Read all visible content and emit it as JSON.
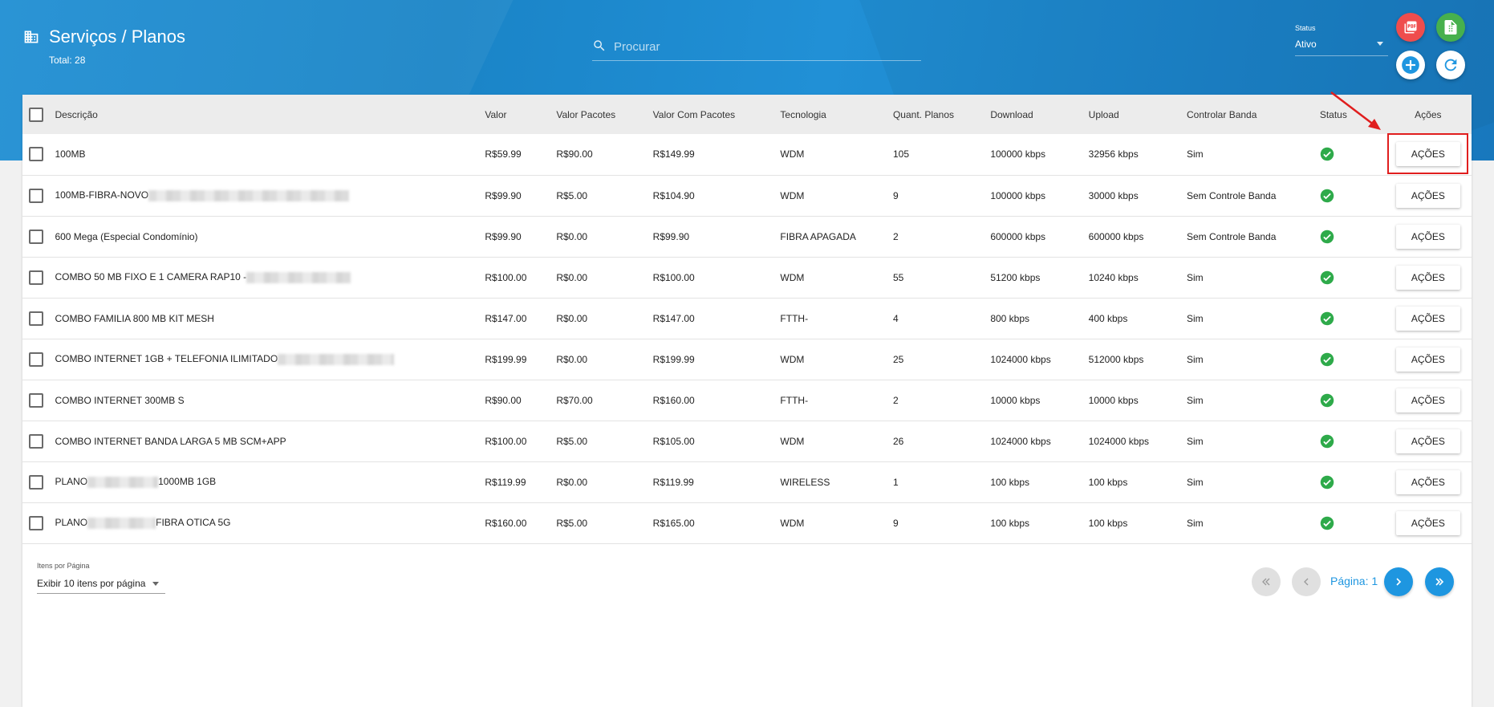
{
  "header": {
    "title": "Serviços / Planos",
    "total": "Total: 28",
    "search_placeholder": "Procurar",
    "status_label": "Status",
    "status_value": "Ativo"
  },
  "table": {
    "columns": [
      "Descrição",
      "Valor",
      "Valor Pacotes",
      "Valor Com Pacotes",
      "Tecnologia",
      "Quant. Planos",
      "Download",
      "Upload",
      "Controlar Banda",
      "Status",
      "Ações"
    ],
    "action_label": "AÇÕES",
    "rows": [
      {
        "desc": "100MB",
        "desc_suffix": "",
        "valor": "R$59.99",
        "pacotes": "R$90.00",
        "com_pacotes": "R$149.99",
        "tecnologia": "WDM",
        "quant": "105",
        "download": "100000 kbps",
        "upload": "32956 kbps",
        "banda": "Sim"
      },
      {
        "desc": "100MB-FIBRA-NOVO",
        "desc_suffix": "",
        "valor": "R$99.90",
        "pacotes": "R$5.00",
        "com_pacotes": "R$104.90",
        "tecnologia": "WDM",
        "quant": "9",
        "download": "100000 kbps",
        "upload": "30000 kbps",
        "banda": "Sem Controle Banda"
      },
      {
        "desc": "600 Mega (Especial Condomínio)",
        "desc_suffix": "",
        "valor": "R$99.90",
        "pacotes": "R$0.00",
        "com_pacotes": "R$99.90",
        "tecnologia": "FIBRA APAGADA",
        "quant": "2",
        "download": "600000 kbps",
        "upload": "600000 kbps",
        "banda": "Sem Controle Banda"
      },
      {
        "desc": "COMBO 50 MB FIXO E 1 CAMERA RAP10 -",
        "desc_suffix": "",
        "valor": "R$100.00",
        "pacotes": "R$0.00",
        "com_pacotes": "R$100.00",
        "tecnologia": "WDM",
        "quant": "55",
        "download": "51200 kbps",
        "upload": "10240 kbps",
        "banda": "Sim"
      },
      {
        "desc": "COMBO FAMILIA 800 MB KIT MESH",
        "desc_suffix": "",
        "valor": "R$147.00",
        "pacotes": "R$0.00",
        "com_pacotes": "R$147.00",
        "tecnologia": "FTTH-",
        "quant": "4",
        "download": "800 kbps",
        "upload": "400 kbps",
        "banda": "Sim"
      },
      {
        "desc": "COMBO INTERNET 1GB + TELEFONIA ILIMITADO",
        "desc_suffix": "",
        "valor": "R$199.99",
        "pacotes": "R$0.00",
        "com_pacotes": "R$199.99",
        "tecnologia": "WDM",
        "quant": "25",
        "download": "1024000 kbps",
        "upload": "512000 kbps",
        "banda": "Sim"
      },
      {
        "desc": "COMBO INTERNET 300MB S",
        "desc_suffix": "",
        "valor": "R$90.00",
        "pacotes": "R$70.00",
        "com_pacotes": "R$160.00",
        "tecnologia": "FTTH-",
        "quant": "2",
        "download": "10000 kbps",
        "upload": "10000 kbps",
        "banda": "Sim"
      },
      {
        "desc": "COMBO INTERNET BANDA LARGA 5 MB SCM+APP",
        "desc_suffix": "",
        "valor": "R$100.00",
        "pacotes": "R$5.00",
        "com_pacotes": "R$105.00",
        "tecnologia": "WDM",
        "quant": "26",
        "download": "1024000 kbps",
        "upload": "1024000 kbps",
        "banda": "Sim"
      },
      {
        "desc": "PLANO",
        "desc_suffix": "1000MB 1GB",
        "valor": "R$119.99",
        "pacotes": "R$0.00",
        "com_pacotes": "R$119.99",
        "tecnologia": "WIRELESS",
        "quant": "1",
        "download": "100 kbps",
        "upload": "100 kbps",
        "banda": "Sim"
      },
      {
        "desc": "PLANO",
        "desc_suffix": "FIBRA OTICA 5G",
        "valor": "R$160.00",
        "pacotes": "R$5.00",
        "com_pacotes": "R$165.00",
        "tecnologia": "WDM",
        "quant": "9",
        "download": "100 kbps",
        "upload": "100 kbps",
        "banda": "Sim"
      }
    ]
  },
  "footer": {
    "per_page_label": "Itens por Página",
    "per_page_value": "Exibir 10 itens por página",
    "page_label": "Página: 1"
  },
  "colors": {
    "header_blue": "#1f8fd3",
    "status_green": "#2eaa4a",
    "pdf_red": "#ef4d4d",
    "excel_green": "#47b04d",
    "pagination_blue": "#1e96e0",
    "highlight_red": "#e01e1e"
  },
  "icons": {
    "title": "building-icon",
    "search": "search-icon",
    "pdf": "pdf-icon",
    "excel": "excel-icon",
    "add": "add-circle-icon",
    "refresh": "refresh-icon",
    "status": "check-circle-icon"
  }
}
